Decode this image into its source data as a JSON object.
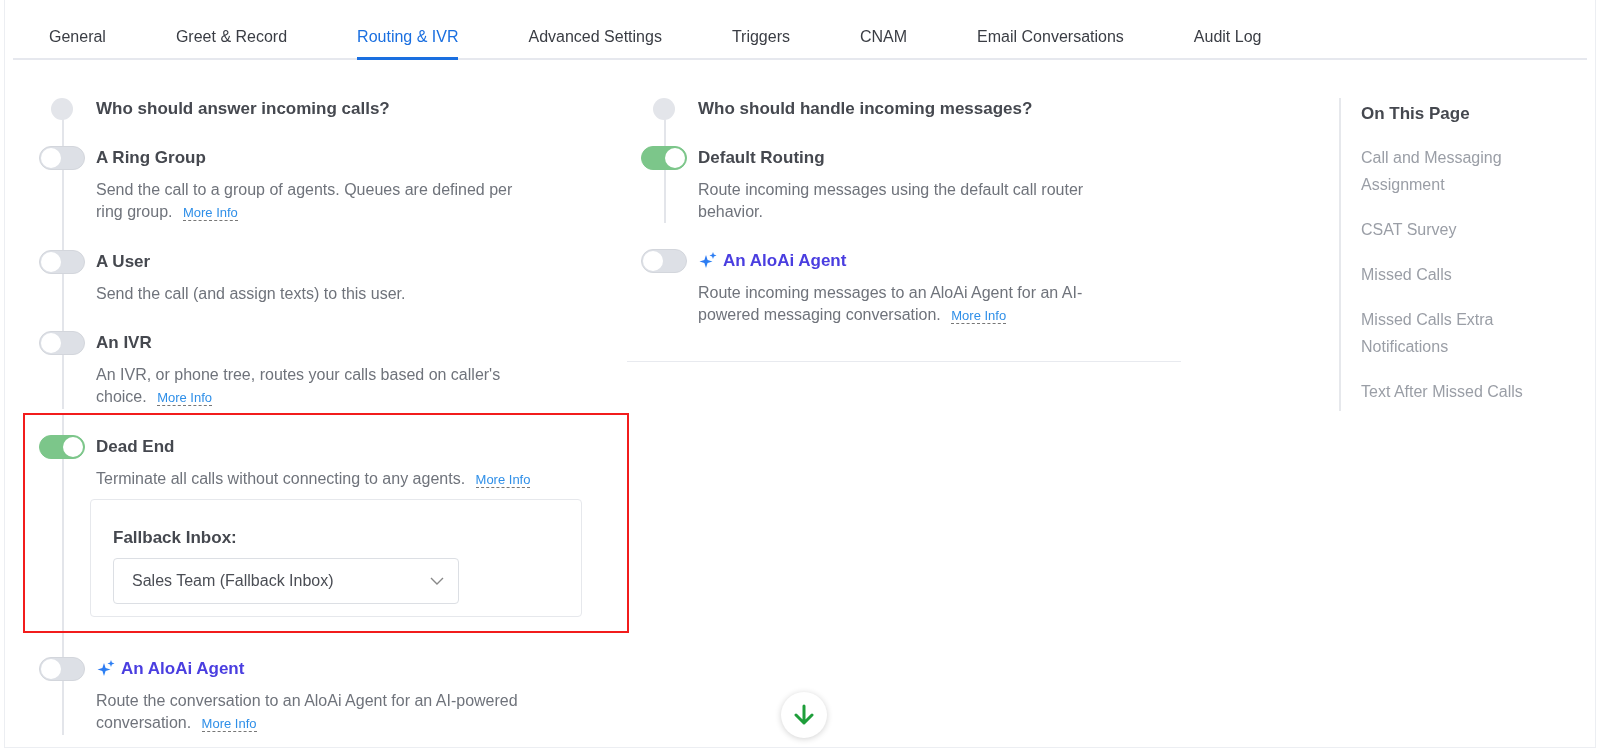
{
  "tabs": [
    {
      "label": "General",
      "selected": false
    },
    {
      "label": "Greet & Record",
      "selected": false
    },
    {
      "label": "Routing & IVR",
      "selected": true
    },
    {
      "label": "Advanced Settings",
      "selected": false
    },
    {
      "label": "Triggers",
      "selected": false
    },
    {
      "label": "CNAM",
      "selected": false
    },
    {
      "label": "Email Conversations",
      "selected": false
    },
    {
      "label": "Audit Log",
      "selected": false
    }
  ],
  "calls": {
    "heading": "Who should answer incoming calls?",
    "options": [
      {
        "kind": "plain",
        "title": "A Ring Group",
        "on": false,
        "highlighted": false,
        "description": "Send the call to a group of agents. Queues are defined per ring group.",
        "link": "More Info"
      },
      {
        "kind": "plain",
        "title": "A User",
        "on": false,
        "highlighted": false,
        "description": "Send the call (and assign texts) to this user."
      },
      {
        "kind": "plain",
        "title": "An IVR",
        "on": false,
        "highlighted": false,
        "description": "An IVR, or phone tree, routes your calls based on caller's choice.",
        "link": "More Info"
      },
      {
        "kind": "plain",
        "title": "Dead End",
        "on": true,
        "highlighted": true,
        "description": "Terminate all calls without connecting to any agents.",
        "link": "More Info",
        "fallback": {
          "label": "Fallback Inbox:",
          "value": "Sales Team (Fallback Inbox)"
        }
      },
      {
        "kind": "ai",
        "title": "An AloAi Agent",
        "on": false,
        "highlighted": false,
        "description": "Route the conversation to an AloAi Agent for an AI-powered conversation.",
        "link": "More Info"
      }
    ]
  },
  "messages": {
    "heading": "Who should handle incoming messages?",
    "options": [
      {
        "kind": "plain",
        "title": "Default Routing",
        "on": true,
        "highlighted": false,
        "description": "Route incoming messages using the default call router behavior."
      },
      {
        "kind": "ai",
        "title": "An AloAi Agent",
        "on": false,
        "highlighted": false,
        "description": "Route incoming messages to an AloAi Agent for an AI-powered messaging conversation.",
        "link": "More Info"
      }
    ]
  },
  "toc": {
    "title": "On This Page",
    "items": [
      "Call and Messaging Assignment",
      "CSAT Survey",
      "Missed Calls",
      "Missed Calls Extra Notifications",
      "Text After Missed Calls"
    ]
  }
}
